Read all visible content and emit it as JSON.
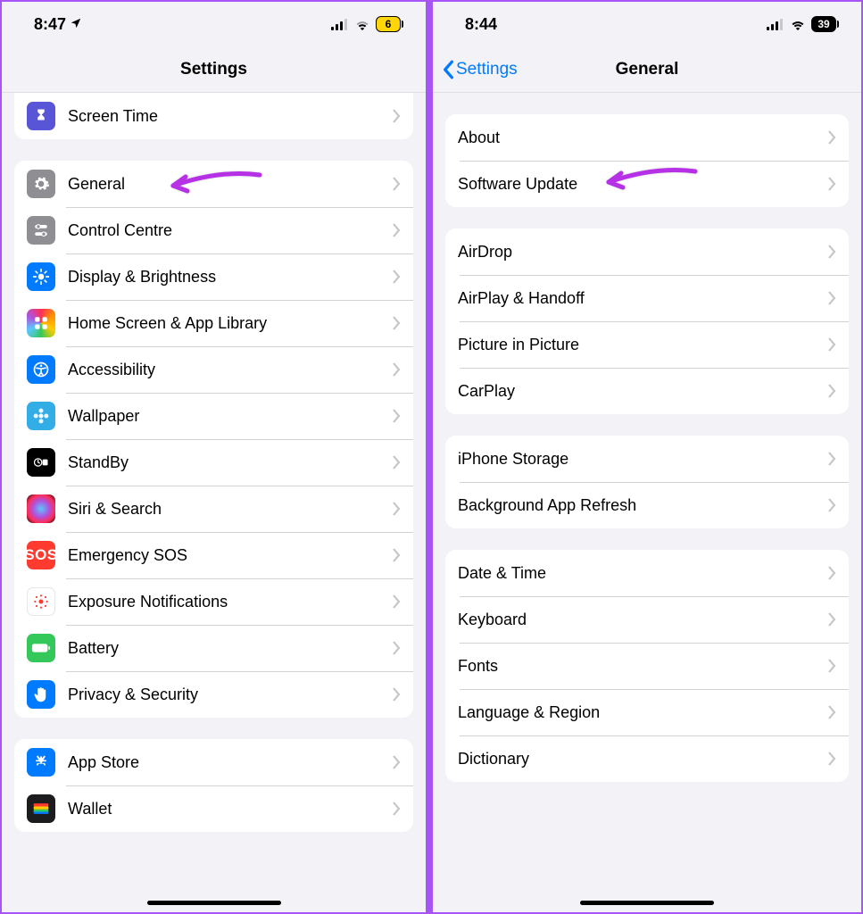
{
  "left": {
    "status": {
      "time": "8:47",
      "battery": "6"
    },
    "nav": {
      "title": "Settings"
    },
    "group0": {
      "screen_time": "Screen Time"
    },
    "group1": {
      "general": "General",
      "control_centre": "Control Centre",
      "display": "Display & Brightness",
      "home_screen": "Home Screen & App Library",
      "accessibility": "Accessibility",
      "wallpaper": "Wallpaper",
      "standby": "StandBy",
      "siri": "Siri & Search",
      "sos": "Emergency SOS",
      "exposure": "Exposure Notifications",
      "battery": "Battery",
      "privacy": "Privacy & Security"
    },
    "group2": {
      "app_store": "App Store",
      "wallet": "Wallet"
    }
  },
  "right": {
    "status": {
      "time": "8:44",
      "battery": "39"
    },
    "nav": {
      "back": "Settings",
      "title": "General"
    },
    "g1": {
      "about": "About",
      "software_update": "Software Update"
    },
    "g2": {
      "airdrop": "AirDrop",
      "airplay": "AirPlay & Handoff",
      "pip": "Picture in Picture",
      "carplay": "CarPlay"
    },
    "g3": {
      "storage": "iPhone Storage",
      "bg_refresh": "Background App Refresh"
    },
    "g4": {
      "date_time": "Date & Time",
      "keyboard": "Keyboard",
      "fonts": "Fonts",
      "lang_region": "Language & Region",
      "dictionary": "Dictionary"
    }
  },
  "sos_text": "SOS"
}
